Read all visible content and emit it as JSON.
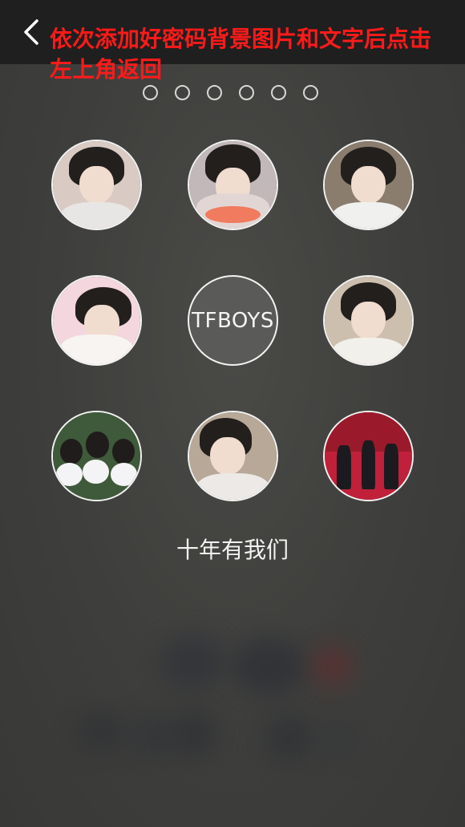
{
  "header": {
    "hint_text": "依次添加好密码背景图片和文字后点击左上角返回",
    "hint_color": "#ff1a1a"
  },
  "pager": {
    "dot_count": 6
  },
  "grid": {
    "cells": [
      {
        "name": "photo-cell-1",
        "kind": "photo"
      },
      {
        "name": "photo-cell-2",
        "kind": "photo"
      },
      {
        "name": "photo-cell-3",
        "kind": "photo"
      },
      {
        "name": "photo-cell-4",
        "kind": "photo"
      },
      {
        "name": "center-text-cell",
        "kind": "text",
        "label": "TFBOYS"
      },
      {
        "name": "photo-cell-6",
        "kind": "photo"
      },
      {
        "name": "photo-cell-7",
        "kind": "photo"
      },
      {
        "name": "photo-cell-8",
        "kind": "photo"
      },
      {
        "name": "photo-cell-9",
        "kind": "photo"
      }
    ]
  },
  "caption": "十年有我们",
  "icons": {
    "back": "back-arrow-icon"
  }
}
